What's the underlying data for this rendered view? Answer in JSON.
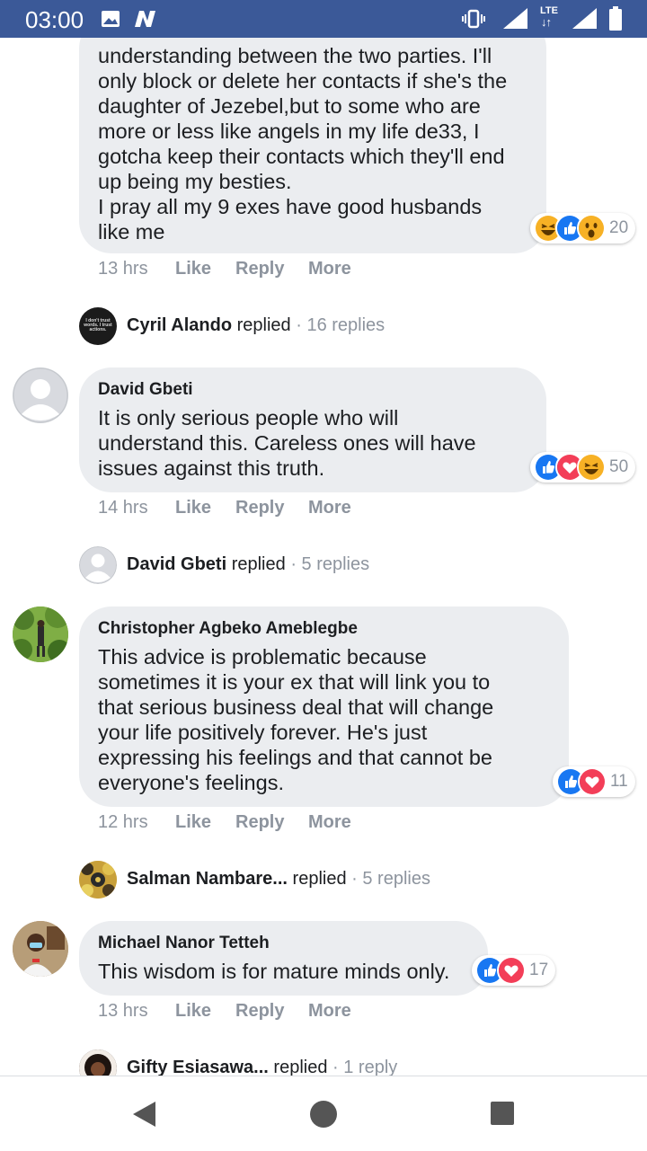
{
  "status_bar": {
    "time": "03:00",
    "network": "LTE"
  },
  "comments": [
    {
      "id": "c1",
      "text": "understanding between the two parties. I'll\nonly block or delete her contacts if she's the\ndaughter of Jezebel,but to some who are\nmore or less like angels in my life de33, I\ngotcha keep their contacts which they'll end\nup being my besties.\nI pray all my 9 exes have good husbands\nlike me",
      "time": "13 hrs",
      "reaction_count": "20",
      "replied_by": "Cyril Alando",
      "replied_word": "replied",
      "replies": "· 16 replies"
    },
    {
      "id": "c2",
      "author": "David Gbeti",
      "text": "It is only serious people who will\nunderstand this. Careless ones will have\nissues against this truth.",
      "time": "14 hrs",
      "reaction_count": "50",
      "replied_by": "David Gbeti",
      "replied_word": "replied",
      "replies": "· 5 replies"
    },
    {
      "id": "c3",
      "author": "Christopher Agbeko Ameblegbe",
      "text": "This advice is problematic because\nsometimes it is your ex that will link you to\nthat serious business deal that will change\nyour life positively forever. He's just\nexpressing his feelings and that cannot be\neveryone's feelings.",
      "time": "12 hrs",
      "reaction_count": "11",
      "replied_by": "Salman Nambare...",
      "replied_word": "replied",
      "replies": "· 5 replies"
    },
    {
      "id": "c4",
      "author": "Michael Nanor Tetteh",
      "text": "This wisdom is for mature minds only.",
      "time": "13 hrs",
      "reaction_count": "17",
      "replied_by": "Gifty Esiasawa...",
      "replied_word": "replied",
      "replies": "· 1 reply"
    }
  ],
  "actions": {
    "like": "Like",
    "reply": "Reply",
    "more": "More"
  },
  "cyril_avatar_text": "I don't trust words. I trust actions.",
  "colors": {
    "status_bar": "#3b5998",
    "bubble": "#ebedf0",
    "like_blue": "#1877f2",
    "love_red": "#f33e58",
    "haha_yellow": "#f7b125",
    "meta_gray": "#8d949e"
  }
}
